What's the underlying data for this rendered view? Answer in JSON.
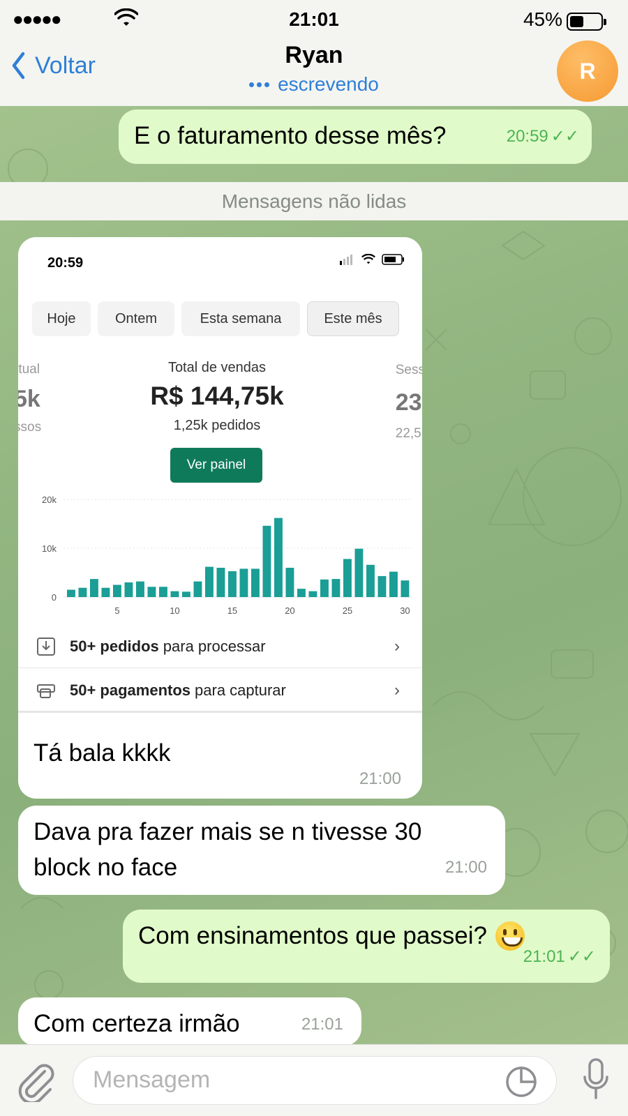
{
  "status_bar": {
    "time": "21:01",
    "battery": "45%"
  },
  "header": {
    "back_label": "Voltar",
    "title": "Ryan",
    "subtitle": "escrevendo",
    "avatar_initial": "R"
  },
  "messages": {
    "m1": {
      "text": "E o faturamento desse mês?",
      "time": "20:59",
      "ticks": "✓✓"
    },
    "unread_label": "Mensagens não lidas",
    "screenshot": {
      "time": "20:59",
      "tabs": [
        "Hoje",
        "Ontem",
        "Esta semana",
        "Este mês"
      ],
      "active_tab": "Este mês",
      "left_stat": {
        "label": "rtual",
        "value": "5k",
        "sub": "ssos"
      },
      "center_stat": {
        "label": "Total de vendas",
        "value": "R$ 144,75k",
        "sub": "1,25k pedidos"
      },
      "right_stat": {
        "label": "Sess",
        "value": "23",
        "sub": "22,5"
      },
      "button": "Ver painel",
      "rows": [
        {
          "bold": "50+ pedidos",
          "rest": "para processar"
        },
        {
          "bold": "50+ pagamentos",
          "rest": "para capturar"
        }
      ]
    },
    "m2": {
      "text": "Tá bala kkkk",
      "time": "21:00"
    },
    "m3": {
      "line1": "Dava pra fazer mais se n tivesse 30",
      "line2": "block no face",
      "time": "21:00"
    },
    "m4": {
      "text": "Com ensinamentos que passei?",
      "time": "21:01",
      "ticks": "✓✓"
    },
    "m5": {
      "text": "Com certeza irmão",
      "time": "21:01"
    }
  },
  "input": {
    "placeholder": "Mensagem"
  },
  "colors": {
    "accent": "#2f7fd8",
    "outgoing_bubble": "#e0fbc9",
    "chart_bar": "#1a9e95",
    "button": "#0f7a5a"
  },
  "chart_data": {
    "type": "bar",
    "x": [
      1,
      2,
      3,
      4,
      5,
      6,
      7,
      8,
      9,
      10,
      11,
      12,
      13,
      14,
      15,
      16,
      17,
      18,
      19,
      20,
      21,
      22,
      23,
      24,
      25,
      26,
      27,
      28,
      29,
      30
    ],
    "values": [
      1500,
      1900,
      3700,
      1900,
      2500,
      3000,
      3200,
      2100,
      2100,
      1200,
      1100,
      3200,
      6200,
      6000,
      5300,
      5800,
      5800,
      14600,
      16200,
      6000,
      1700,
      1200,
      3600,
      3700,
      7800,
      9900,
      6600,
      4300,
      5200,
      3400
    ],
    "xticks": [
      "5",
      "10",
      "15",
      "20",
      "25",
      "30"
    ],
    "yticks": [
      "0",
      "10k",
      "20k"
    ],
    "ylim": [
      0,
      20000
    ],
    "xlabel": "",
    "ylabel": ""
  }
}
